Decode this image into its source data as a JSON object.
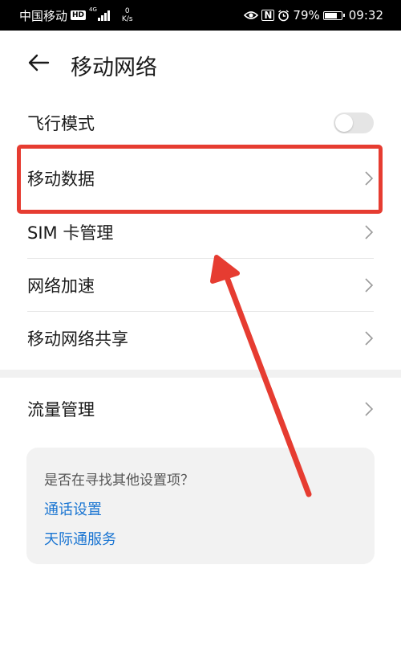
{
  "status_bar": {
    "carrier": "中国移动",
    "hd_badge": "HD",
    "signal_type": "4G",
    "speed_value": "0",
    "speed_unit": "K/s",
    "battery_percent": "79%",
    "battery_level": 0.79,
    "time": "09:32"
  },
  "header": {
    "title": "移动网络"
  },
  "items": [
    {
      "label": "飞行模式",
      "control": "toggle",
      "toggle_on": false
    },
    {
      "label": "移动数据",
      "control": "chevron"
    },
    {
      "label": "SIM 卡管理",
      "control": "chevron"
    },
    {
      "label": "网络加速",
      "control": "chevron"
    },
    {
      "label": "移动网络共享",
      "control": "chevron"
    }
  ],
  "traffic": {
    "label": "流量管理"
  },
  "suggestion": {
    "question": "是否在寻找其他设置项？",
    "links": [
      "通话设置",
      "天际通服务"
    ]
  },
  "colors": {
    "highlight": "#e63c31",
    "link": "#1a75d2",
    "status_bar_bg": "#000000"
  },
  "icons": [
    "back-arrow-icon",
    "chevron-right-icon",
    "eye-icon",
    "nfc-icon",
    "alarm-icon",
    "battery-icon",
    "signal-icon"
  ]
}
